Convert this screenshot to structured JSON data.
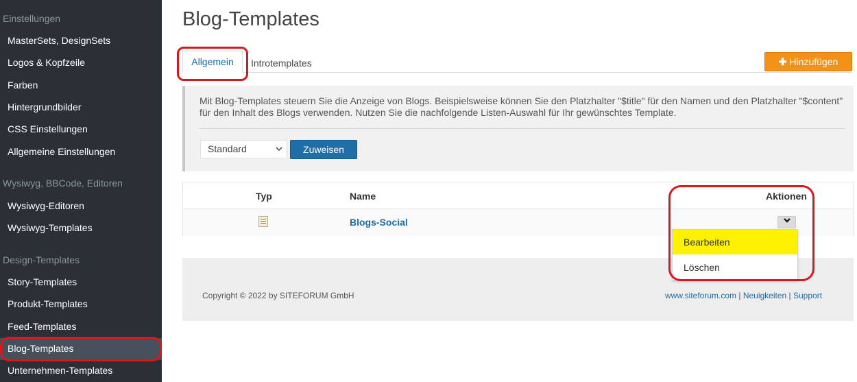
{
  "sidebar": {
    "groups": [
      {
        "heading": "Einstellungen",
        "items": [
          "MasterSets, DesignSets",
          "Logos & Kopfzeile",
          "Farben",
          "Hintergrundbilder",
          "CSS Einstellungen",
          "Allgemeine Einstellungen"
        ]
      },
      {
        "heading": "Wysiwyg, BBCode, Editoren",
        "items": [
          "Wysiwyg-Editoren",
          "Wysiwyg-Templates"
        ]
      },
      {
        "heading": "Design-Templates",
        "items": [
          "Story-Templates",
          "Produkt-Templates",
          "Feed-Templates",
          "Blog-Templates",
          "Unternehmen-Templates"
        ]
      }
    ],
    "active_item": "Blog-Templates"
  },
  "main": {
    "title": "Blog-Templates",
    "tabs": [
      {
        "label": "Allgemein",
        "active": true
      },
      {
        "label": "Introtemplates",
        "active": false
      }
    ],
    "add_button": {
      "label": "Hinzufügen",
      "icon": "plus-icon"
    },
    "info_text": "Mit Blog-Templates steuern Sie die Anzeige von Blogs. Beispielsweise können Sie den Platzhalter \"$title\" für den Namen und den Platzhalter \"$content\" für den Inhalt des Blogs verwenden. Nutzen Sie die nachfolgende Listen-Auswahl für Ihr gewünschtes Template.",
    "select": {
      "value": "Standard"
    },
    "assign_button": "Zuweisen",
    "table": {
      "columns": [
        "Typ",
        "Name",
        "Aktionen"
      ],
      "rows": [
        {
          "type_icon": "template-icon",
          "name": "Blogs-Social"
        }
      ]
    },
    "actions_menu": [
      "Bearbeiten",
      "Löschen"
    ]
  },
  "footer": {
    "copyright": "Copyright © 2022 by SITEFORUM GmbH",
    "links": [
      "www.siteforum.com",
      "Neuigkeiten",
      "Support"
    ]
  },
  "colors": {
    "sidebar_bg": "#2b3037",
    "accent_blue": "#1f6ea8",
    "add_orange": "#f39118",
    "highlight_yellow": "#fff200",
    "annotation_red": "#e0141c"
  }
}
